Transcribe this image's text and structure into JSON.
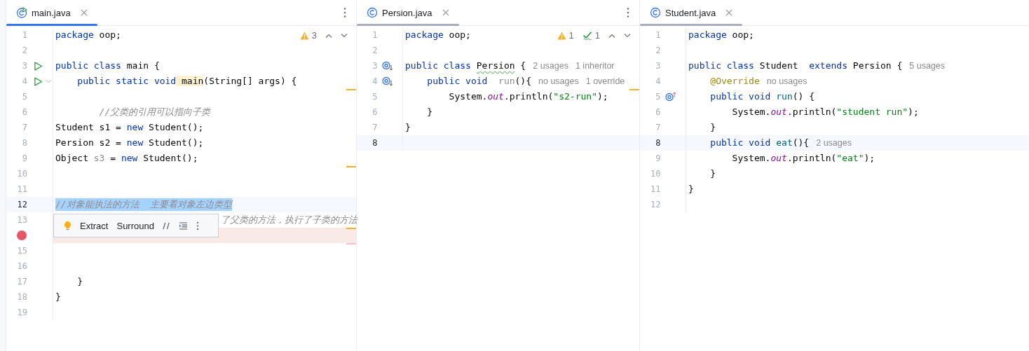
{
  "panes": [
    {
      "tab": {
        "label": "main.java",
        "kind": "runnable",
        "focused": true
      },
      "menu": true,
      "inspections": [
        {
          "kind": "warning",
          "count": "3"
        }
      ],
      "popup": {
        "actions": [
          "Extract",
          "Surround"
        ]
      },
      "lines": [
        {
          "n": "1",
          "tokens": [
            {
              "kind": "kw",
              "text": "package"
            },
            {
              "kind": "p",
              "text": " oop;"
            }
          ]
        },
        {
          "n": "2"
        },
        {
          "n": "3",
          "gutter": {
            "kind": "run"
          },
          "tokens": [
            {
              "kind": "kw",
              "text": "public class"
            },
            {
              "kind": "p",
              "text": " main {"
            }
          ]
        },
        {
          "n": "4",
          "gutter": {
            "kind": "run"
          },
          "fold": true,
          "tokens": [
            {
              "kind": "kw",
              "text": "    public static void"
            },
            {
              "kind": "match",
              "text": " main"
            },
            {
              "kind": "p",
              "text": "(String[] args) {"
            }
          ]
        },
        {
          "n": "5",
          "stripe": {
            "kind": "warning"
          }
        },
        {
          "n": "6",
          "tokens": [
            {
              "kind": "c",
              "text": "        //父类的引用可以指向子类"
            }
          ]
        },
        {
          "n": "7",
          "tokens": [
            {
              "kind": "p",
              "text": "Student s1 ="
            },
            {
              "kind": "kw",
              "text": " new"
            },
            {
              "kind": "p",
              "text": " Student();"
            }
          ]
        },
        {
          "n": "8",
          "tokens": [
            {
              "kind": "p",
              "text": "Persion s2 ="
            },
            {
              "kind": "kw",
              "text": " new"
            },
            {
              "kind": "p",
              "text": " Student();"
            }
          ]
        },
        {
          "n": "9",
          "tokens": [
            {
              "kind": "p",
              "text": "Object"
            },
            {
              "kind": "unused",
              "text": " s3"
            },
            {
              "kind": "p",
              "text": " ="
            },
            {
              "kind": "kw",
              "text": " new"
            },
            {
              "kind": "p",
              "text": " Student();"
            }
          ]
        },
        {
          "n": "10",
          "stripe": {
            "kind": "warning"
          }
        },
        {
          "n": "11"
        },
        {
          "n": "12",
          "current": true,
          "selected": true,
          "tokens": [
            {
              "kind": "c",
              "text": "//对象能执法的方法  主要看对象左边类型"
            }
          ]
        },
        {
          "n": "13",
          "covered": true,
          "tokens": [
            {
              "kind": "c",
              "text": "了父类的方法，执行了子类的方法"
            }
          ]
        },
        {
          "breakpoint": true,
          "stripe": {
            "kind": "warning"
          }
        },
        {
          "n": "15",
          "stripe": {
            "kind": "error"
          }
        },
        {
          "n": "16"
        },
        {
          "n": "17",
          "tokens": [
            {
              "kind": "p",
              "text": "    }"
            }
          ]
        },
        {
          "n": "18",
          "tokens": [
            {
              "kind": "p",
              "text": "}"
            }
          ]
        },
        {
          "n": "19"
        }
      ]
    },
    {
      "tab": {
        "label": "Persion.java",
        "kind": "class",
        "focused": false
      },
      "menu": true,
      "inspections": [
        {
          "kind": "warning",
          "count": "1"
        },
        {
          "kind": "ok",
          "count": "1"
        }
      ],
      "lines": [
        {
          "n": "1",
          "tokens": [
            {
              "kind": "kw",
              "text": "package"
            },
            {
              "kind": "p",
              "text": " oop;"
            }
          ]
        },
        {
          "n": "2"
        },
        {
          "n": "3",
          "gutter": {
            "kind": "overridden"
          },
          "tokens": [
            {
              "kind": "kw",
              "text": "public class "
            },
            {
              "kind": "warn",
              "text": "Persion"
            },
            {
              "kind": "p",
              "text": " {"
            }
          ],
          "hints": [
            "2 usages",
            "1 inheritor"
          ]
        },
        {
          "n": "4",
          "gutter": {
            "kind": "overridden"
          },
          "tokens": [
            {
              "kind": "kw",
              "text": "    public void"
            },
            {
              "kind": "unused",
              "text": "  run"
            },
            {
              "kind": "p",
              "text": "(){"
            }
          ],
          "hints": [
            "no usages",
            "1 override"
          ]
        },
        {
          "n": "5",
          "stripe": {
            "kind": "warning"
          },
          "tokens": [
            {
              "kind": "p",
              "text": "        System."
            },
            {
              "kind": "field",
              "text": "out"
            },
            {
              "kind": "p",
              "text": ".println("
            },
            {
              "kind": "str",
              "text": "\"s2-run\""
            },
            {
              "kind": "p",
              "text": ");"
            }
          ]
        },
        {
          "n": "6",
          "tokens": [
            {
              "kind": "p",
              "text": "    }"
            }
          ]
        },
        {
          "n": "7",
          "tokens": [
            {
              "kind": "p",
              "text": "}"
            }
          ]
        },
        {
          "n": "8",
          "current": true
        }
      ]
    },
    {
      "tab": {
        "label": "Student.java",
        "kind": "class",
        "focused": false
      },
      "lines": [
        {
          "n": "1",
          "tokens": [
            {
              "kind": "kw",
              "text": "package"
            },
            {
              "kind": "p",
              "text": " oop;"
            }
          ]
        },
        {
          "n": "2"
        },
        {
          "n": "3",
          "tokens": [
            {
              "kind": "kw",
              "text": "public class"
            },
            {
              "kind": "p",
              "text": " Student  "
            },
            {
              "kind": "kw",
              "text": "extends"
            },
            {
              "kind": "p",
              "text": " Persion {"
            }
          ],
          "hints": [
            "5 usages"
          ]
        },
        {
          "n": "4",
          "tokens": [
            {
              "kind": "ann",
              "text": "    @Override"
            }
          ],
          "hints": [
            "no usages"
          ]
        },
        {
          "n": "5",
          "gutter": {
            "kind": "overrides"
          },
          "tokens": [
            {
              "kind": "kw",
              "text": "    public void"
            },
            {
              "kind": "fn",
              "text": " run"
            },
            {
              "kind": "p",
              "text": "() {"
            }
          ]
        },
        {
          "n": "6",
          "tokens": [
            {
              "kind": "p",
              "text": "        System."
            },
            {
              "kind": "field",
              "text": "out"
            },
            {
              "kind": "p",
              "text": ".println("
            },
            {
              "kind": "str",
              "text": "\"student run\""
            },
            {
              "kind": "p",
              "text": ");"
            }
          ]
        },
        {
          "n": "7",
          "tokens": [
            {
              "kind": "p",
              "text": "    }"
            }
          ]
        },
        {
          "n": "8",
          "current": true,
          "tokens": [
            {
              "kind": "kw",
              "text": "    public void"
            },
            {
              "kind": "fn",
              "text": " eat"
            },
            {
              "kind": "p",
              "text": "(){"
            }
          ],
          "hints": [
            "2 usages"
          ]
        },
        {
          "n": "9",
          "tokens": [
            {
              "kind": "p",
              "text": "        System."
            },
            {
              "kind": "field",
              "text": "out"
            },
            {
              "kind": "p",
              "text": ".println("
            },
            {
              "kind": "str",
              "text": "\"eat\""
            },
            {
              "kind": "p",
              "text": ");"
            }
          ]
        },
        {
          "n": "10",
          "tokens": [
            {
              "kind": "p",
              "text": "    }"
            }
          ]
        },
        {
          "n": "11",
          "tokens": [
            {
              "kind": "p",
              "text": "}"
            }
          ]
        },
        {
          "n": "12"
        }
      ]
    }
  ]
}
